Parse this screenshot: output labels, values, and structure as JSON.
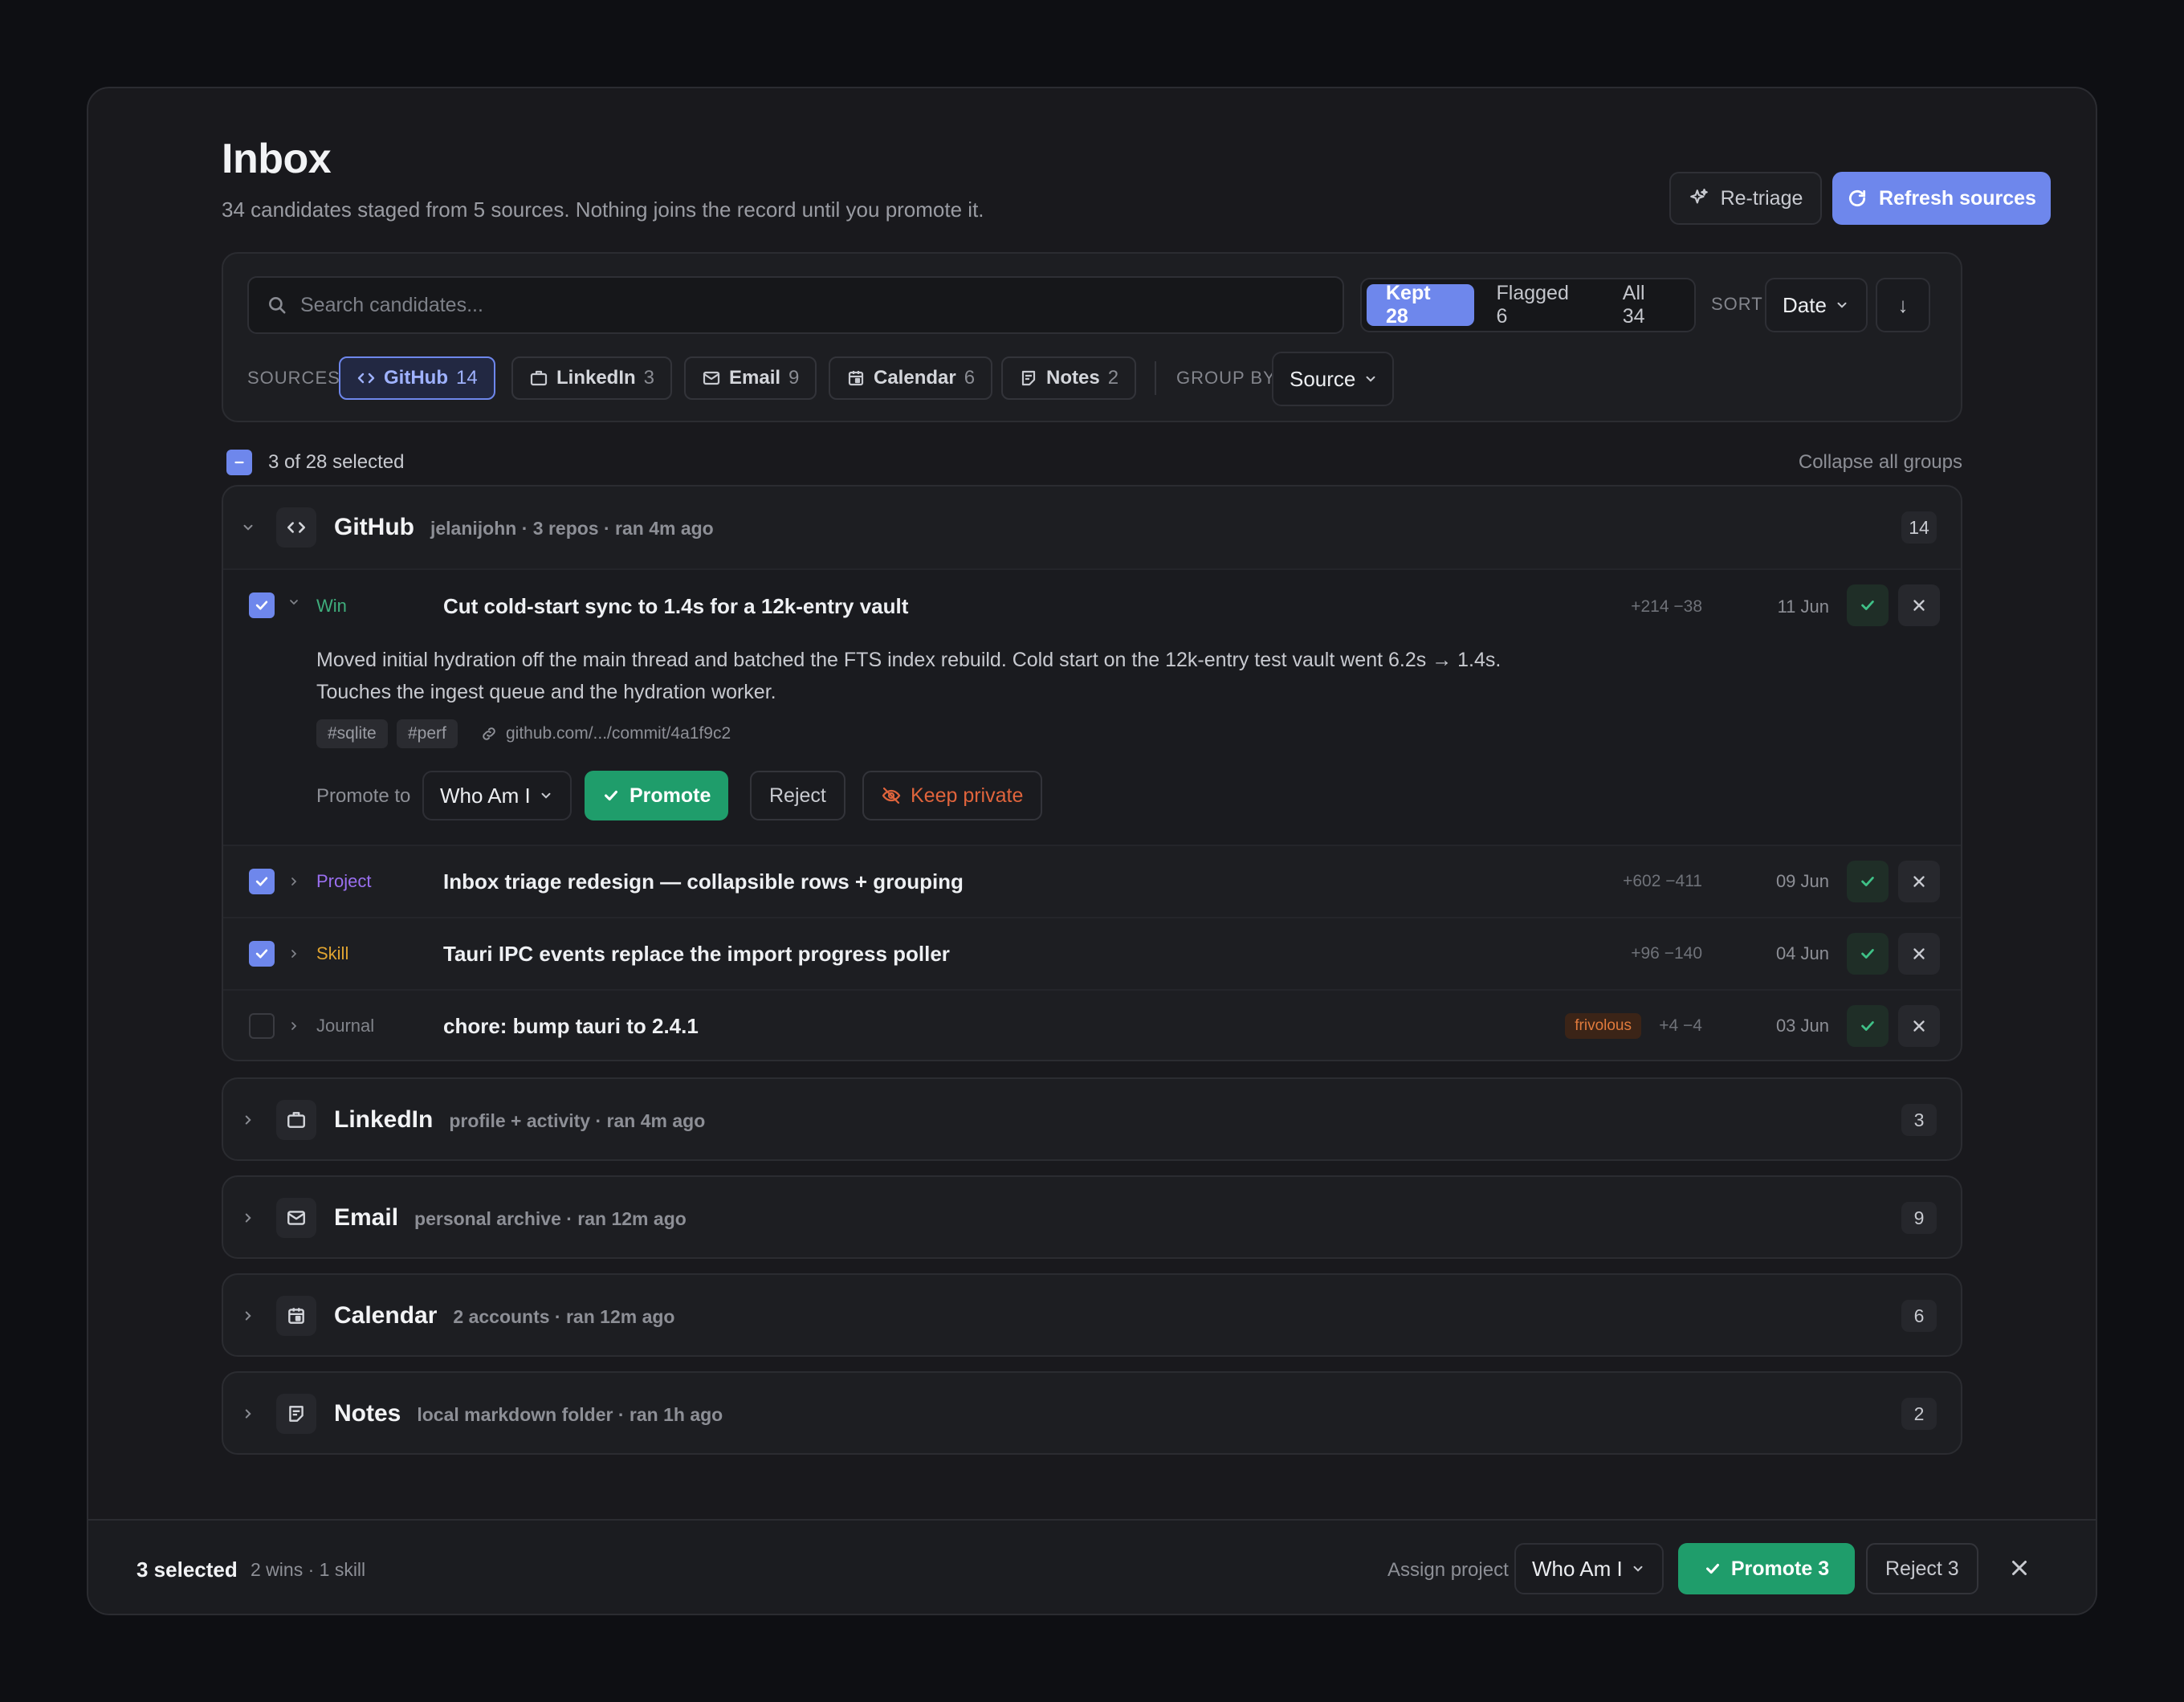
{
  "header": {
    "title": "Inbox",
    "subtitle": "34 candidates staged from 5 sources. Nothing joins the record until you promote it.",
    "retriage_label": "Re-triage",
    "refresh_label": "Refresh sources"
  },
  "filters": {
    "search_placeholder": "Search candidates...",
    "segments": [
      {
        "label": "Kept 28",
        "active": true
      },
      {
        "label": "Flagged 6",
        "active": false
      },
      {
        "label": "All 34",
        "active": false
      }
    ],
    "sort_label": "SORT",
    "sort_value": "Date",
    "sort_direction": "↓",
    "sources_label": "SOURCES",
    "sources": [
      {
        "name": "GitHub",
        "count": "14",
        "icon": "code-icon",
        "active": true
      },
      {
        "name": "LinkedIn",
        "count": "3",
        "icon": "briefcase-icon",
        "active": false
      },
      {
        "name": "Email",
        "count": "9",
        "icon": "mail-icon",
        "active": false
      },
      {
        "name": "Calendar",
        "count": "6",
        "icon": "calendar-icon",
        "active": false
      },
      {
        "name": "Notes",
        "count": "2",
        "icon": "notes-icon",
        "active": false
      }
    ],
    "group_by_label": "GROUP BY",
    "group_by_value": "Source"
  },
  "selection": {
    "summary": "3 of 28 selected",
    "collapse_all": "Collapse all groups"
  },
  "groups": [
    {
      "name": "GitHub",
      "meta": "jelanijohn · 3 repos · ran 4m ago",
      "count": "14",
      "expanded": true,
      "items": [
        {
          "category": "Win",
          "category_color": "#3fae7c",
          "title": "Cut cold-start sync to 1.4s for a 12k-entry vault",
          "diff": "+214 −38",
          "date": "11 Jun",
          "checked": true,
          "expanded": true,
          "description": "Moved initial hydration off the main thread and batched the FTS index rebuild. Cold start on the 12k-entry test vault went 6.2s → 1.4s. Touches the ingest queue and the hydration worker.",
          "tags": [
            "#sqlite",
            "#perf"
          ],
          "link": "github.com/.../commit/4a1f9c2",
          "promote_to_label": "Promote to",
          "promote_to_value": "Who Am I",
          "promote_label": "Promote",
          "reject_label": "Reject",
          "keep_private_label": "Keep private"
        },
        {
          "category": "Project",
          "category_color": "#9a6ff0",
          "title": "Inbox triage redesign — collapsible rows + grouping",
          "diff": "+602 −411",
          "date": "09 Jun",
          "checked": true
        },
        {
          "category": "Skill",
          "category_color": "#e0a431",
          "title": "Tauri IPC events replace the import progress poller",
          "diff": "+96 −140",
          "date": "04 Jun",
          "checked": true
        },
        {
          "category": "Journal",
          "category_color": "#80838a",
          "title": "chore: bump tauri to 2.4.1",
          "flag": "frivolous",
          "diff": "+4 −4",
          "date": "03 Jun",
          "checked": false
        }
      ]
    },
    {
      "name": "LinkedIn",
      "meta": "profile + activity · ran 4m ago",
      "count": "3",
      "icon": "briefcase-icon"
    },
    {
      "name": "Email",
      "meta": "personal archive · ran 12m ago",
      "count": "9",
      "icon": "mail-icon"
    },
    {
      "name": "Calendar",
      "meta": "2 accounts · ran 12m ago",
      "count": "6",
      "icon": "calendar-icon"
    },
    {
      "name": "Notes",
      "meta": "local markdown folder · ran 1h ago",
      "count": "2",
      "icon": "notes-icon"
    }
  ],
  "bottom_bar": {
    "selected_label": "3 selected",
    "breakdown": "2 wins · 1 skill",
    "assign_label": "Assign project",
    "assign_value": "Who Am I",
    "promote_label": "Promote 3",
    "reject_label": "Reject 3"
  },
  "colors": {
    "accent": "#6e87ec",
    "success": "#1f9d6b",
    "danger": "#e0643c",
    "background": "#19191d"
  }
}
